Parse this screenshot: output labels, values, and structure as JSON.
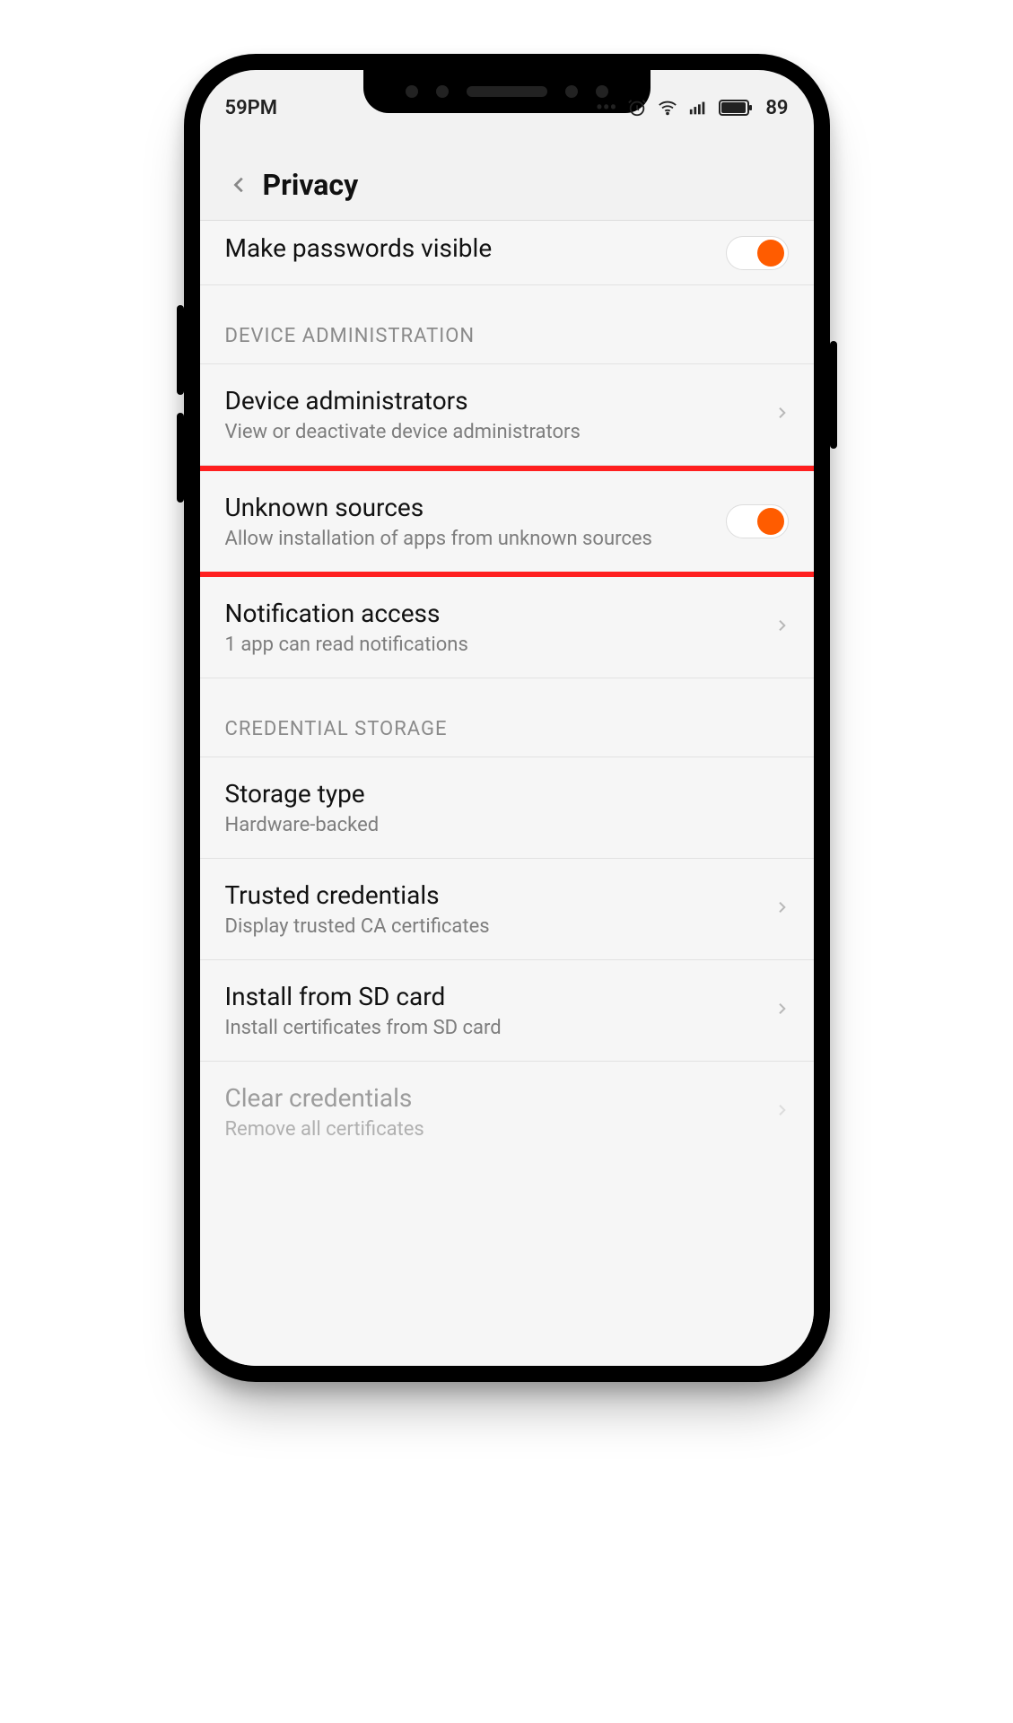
{
  "status": {
    "time": "59PM",
    "battery_text": "89"
  },
  "header": {
    "title": "Privacy"
  },
  "rows": {
    "make_passwords_visible": {
      "title": "Make passwords visible"
    },
    "section_device_admin": "DEVICE ADMINISTRATION",
    "device_administrators": {
      "title": "Device administrators",
      "subtitle": "View or deactivate device administrators"
    },
    "unknown_sources": {
      "title": "Unknown sources",
      "subtitle": "Allow installation of apps from unknown sources"
    },
    "notification_access": {
      "title": "Notification access",
      "subtitle": "1 app can read notifications"
    },
    "section_credential": "CREDENTIAL STORAGE",
    "storage_type": {
      "title": "Storage type",
      "subtitle": "Hardware-backed"
    },
    "trusted_credentials": {
      "title": "Trusted credentials",
      "subtitle": "Display trusted CA certificates"
    },
    "install_sd": {
      "title": "Install from SD card",
      "subtitle": "Install certificates from SD card"
    },
    "clear_credentials": {
      "title": "Clear credentials",
      "subtitle": "Remove all certificates"
    }
  },
  "colors": {
    "accent": "#ff5c00",
    "highlight": "#ff1f1f"
  }
}
